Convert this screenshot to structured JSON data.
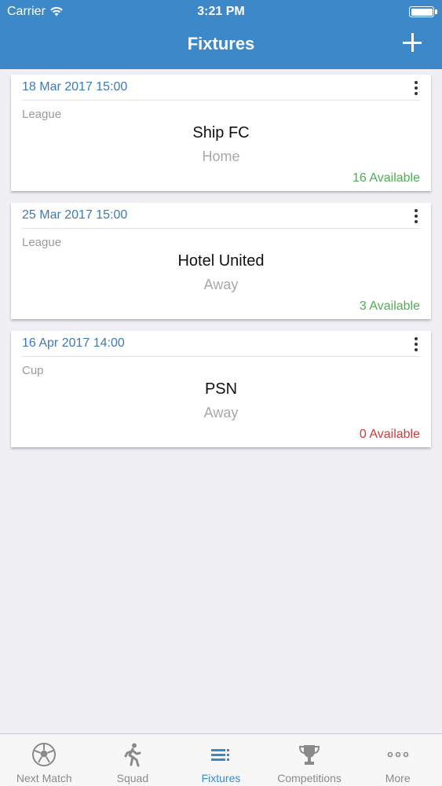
{
  "status_bar": {
    "carrier": "Carrier",
    "time": "3:21 PM"
  },
  "nav": {
    "title": "Fixtures",
    "add_icon": "plus-icon"
  },
  "colors": {
    "brand": "#3d88c8",
    "date_text": "#3d7ab5",
    "available_positive": "#4caf50",
    "available_zero": "#d0393a"
  },
  "fixtures": [
    {
      "date": "18 Mar 2017 15:00",
      "competition": "League",
      "opponent": "Ship FC",
      "venue": "Home",
      "availability": "16 Available",
      "availability_status": "positive"
    },
    {
      "date": "25 Mar 2017 15:00",
      "competition": "League",
      "opponent": "Hotel United",
      "venue": "Away",
      "availability": "3 Available",
      "availability_status": "positive"
    },
    {
      "date": "16 Apr 2017 14:00",
      "competition": "Cup",
      "opponent": "PSN",
      "venue": "Away",
      "availability": "0 Available",
      "availability_status": "zero"
    }
  ],
  "tabs": [
    {
      "label": "Next Match",
      "icon": "soccer-ball-icon",
      "active": false
    },
    {
      "label": "Squad",
      "icon": "running-person-icon",
      "active": false
    },
    {
      "label": "Fixtures",
      "icon": "list-icon",
      "active": true
    },
    {
      "label": "Competitions",
      "icon": "trophy-icon",
      "active": false
    },
    {
      "label": "More",
      "icon": "more-dots-icon",
      "active": false
    }
  ]
}
